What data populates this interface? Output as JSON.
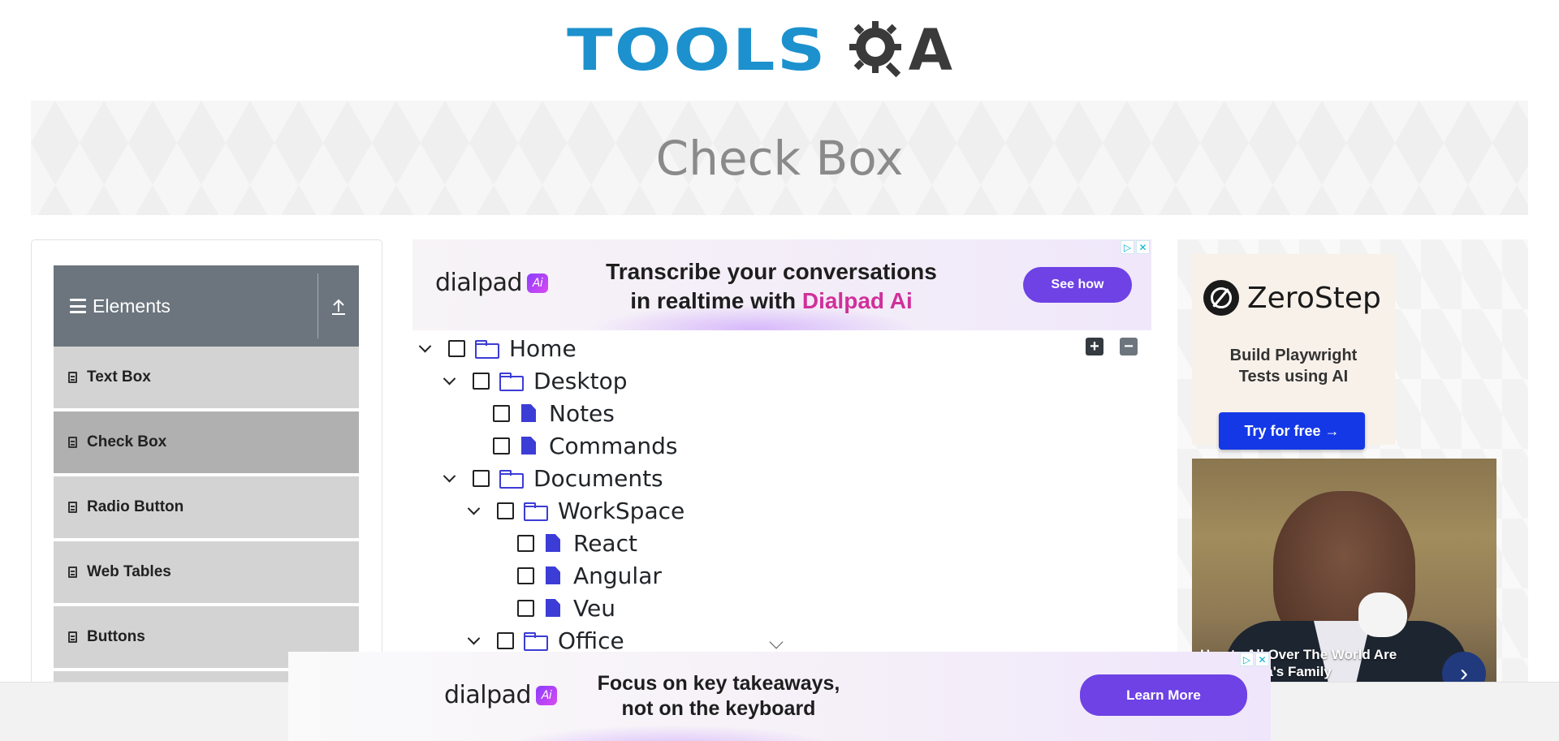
{
  "header": {
    "logo_tools": "TOOLS",
    "logo_qa": "QA",
    "page_title": "Check Box"
  },
  "sidebar": {
    "group_title": "Elements",
    "items": [
      {
        "label": "Text Box",
        "active": false
      },
      {
        "label": "Check Box",
        "active": true
      },
      {
        "label": "Radio Button",
        "active": false
      },
      {
        "label": "Web Tables",
        "active": false
      },
      {
        "label": "Buttons",
        "active": false
      }
    ]
  },
  "ad_top": {
    "brand": "dialpad",
    "brand_badge": "Ai",
    "headline_1": "Transcribe your conversations",
    "headline_2_prefix": "in realtime with",
    "headline_2_highlight": "Dialpad Ai",
    "cta": "See how"
  },
  "tree": {
    "expand_all": "+",
    "collapse_all": "−",
    "nodes": [
      {
        "label": "Home",
        "type": "folder",
        "expanded": true,
        "checked": false
      },
      {
        "label": "Desktop",
        "type": "folder",
        "expanded": true,
        "checked": false
      },
      {
        "label": "Notes",
        "type": "file",
        "checked": false
      },
      {
        "label": "Commands",
        "type": "file",
        "checked": false
      },
      {
        "label": "Documents",
        "type": "folder",
        "expanded": true,
        "checked": false
      },
      {
        "label": "WorkSpace",
        "type": "folder",
        "expanded": true,
        "checked": false
      },
      {
        "label": "React",
        "type": "file",
        "checked": false
      },
      {
        "label": "Angular",
        "type": "file",
        "checked": false
      },
      {
        "label": "Veu",
        "type": "file",
        "checked": false
      },
      {
        "label": "Office",
        "type": "folder",
        "expanded": true,
        "checked": false
      }
    ]
  },
  "ad_right": {
    "brand": "ZeroStep",
    "subtitle_1": "Build Playwright",
    "subtitle_2": "Tests using AI",
    "cta": "Try for free →",
    "photo_caption_1": "Hearts All Over The World Are",
    "photo_caption_2": "For Obama's Family"
  },
  "ad_bottom": {
    "brand": "dialpad",
    "brand_badge": "Ai",
    "headline_1": "Focus on key takeaways,",
    "headline_2": "not on the keyboard",
    "cta": "Learn More"
  },
  "colors": {
    "accent_blue": "#1c91cd",
    "tree_icon": "#3c3cd6",
    "sidebar_header": "#6c757d",
    "cta_purple": "#6e42e5",
    "cta_blue": "#1438e6"
  }
}
